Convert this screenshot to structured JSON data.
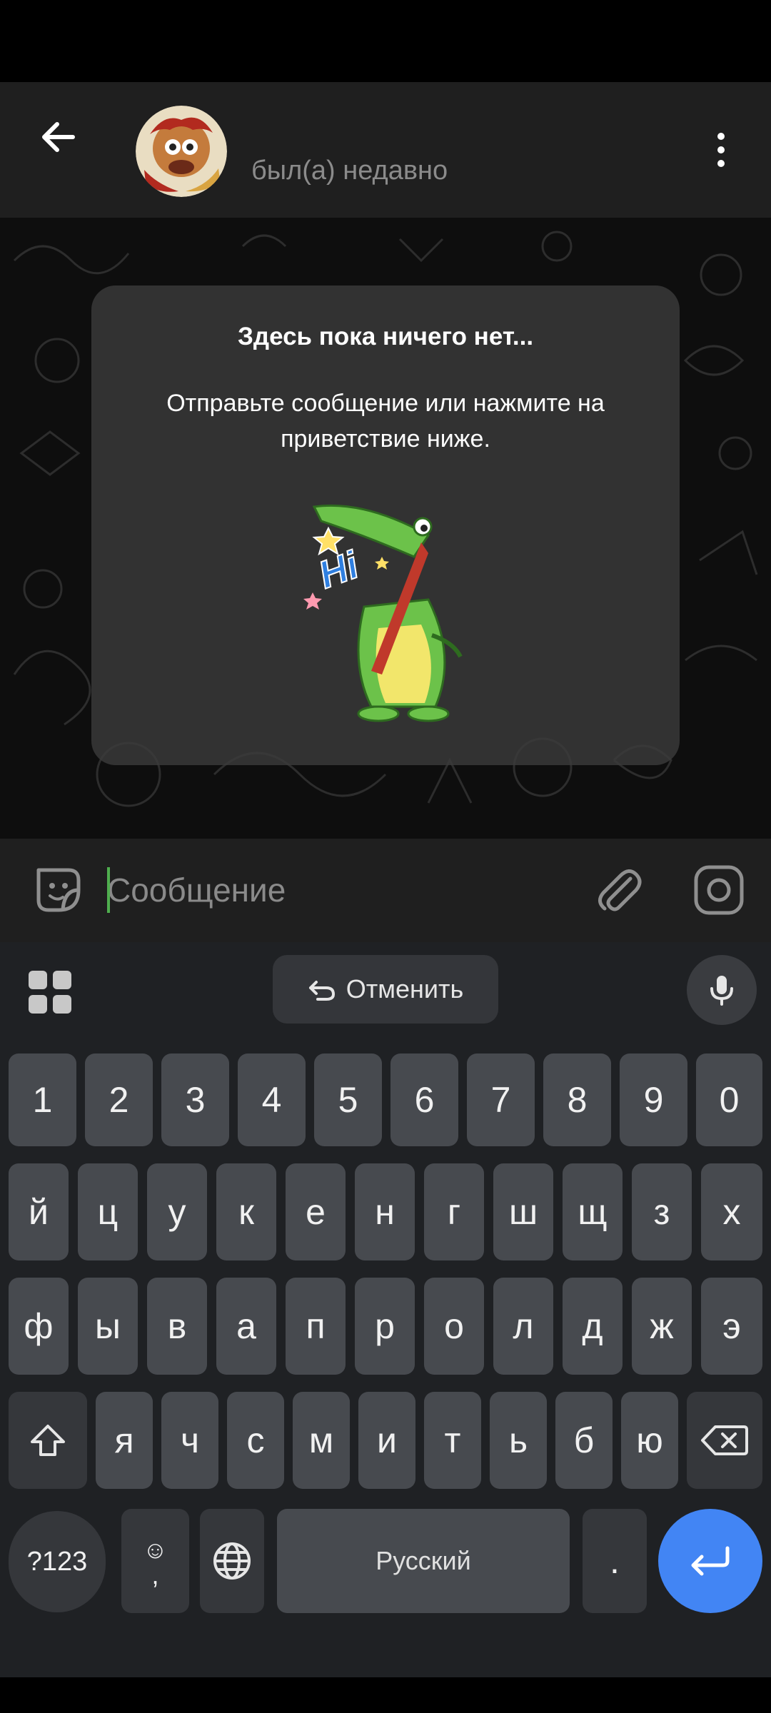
{
  "header": {
    "status": "был(а) недавно"
  },
  "chat": {
    "empty_title": "Здесь пока ничего нет...",
    "empty_hint": "Отправьте сообщение или нажмите на приветствие ниже.",
    "sticker_text": "Hi"
  },
  "composer": {
    "placeholder": "Сообщение"
  },
  "keyboard": {
    "undo_label": "Отменить",
    "row_numbers": [
      "1",
      "2",
      "3",
      "4",
      "5",
      "6",
      "7",
      "8",
      "9",
      "0"
    ],
    "row1": [
      "й",
      "ц",
      "у",
      "к",
      "е",
      "н",
      "г",
      "ш",
      "щ",
      "з",
      "х"
    ],
    "row2": [
      "ф",
      "ы",
      "в",
      "а",
      "п",
      "р",
      "о",
      "л",
      "д",
      "ж",
      "э"
    ],
    "row3": [
      "я",
      "ч",
      "с",
      "м",
      "и",
      "т",
      "ь",
      "б",
      "ю"
    ],
    "symbols_label": "?123",
    "comma_label": ",",
    "space_label": "Русский",
    "period_label": "."
  },
  "colors": {
    "header_bg": "#1f1f1f",
    "keyboard_bg": "#1f2124",
    "key_bg": "#474a4f",
    "enter_accent": "#4285f4",
    "caret": "#4fae4e"
  },
  "icons": {
    "back": "arrow-left-icon",
    "menu": "more-vertical-icon",
    "emoji": "sticker-smile-icon",
    "attach": "paperclip-icon",
    "camera": "instagram-camera-icon",
    "grid": "apps-grid-icon",
    "undo": "undo-icon",
    "mic": "microphone-icon",
    "shift": "shift-arrow-icon",
    "backspace": "backspace-icon",
    "globe": "globe-icon",
    "enter": "enter-return-icon"
  }
}
